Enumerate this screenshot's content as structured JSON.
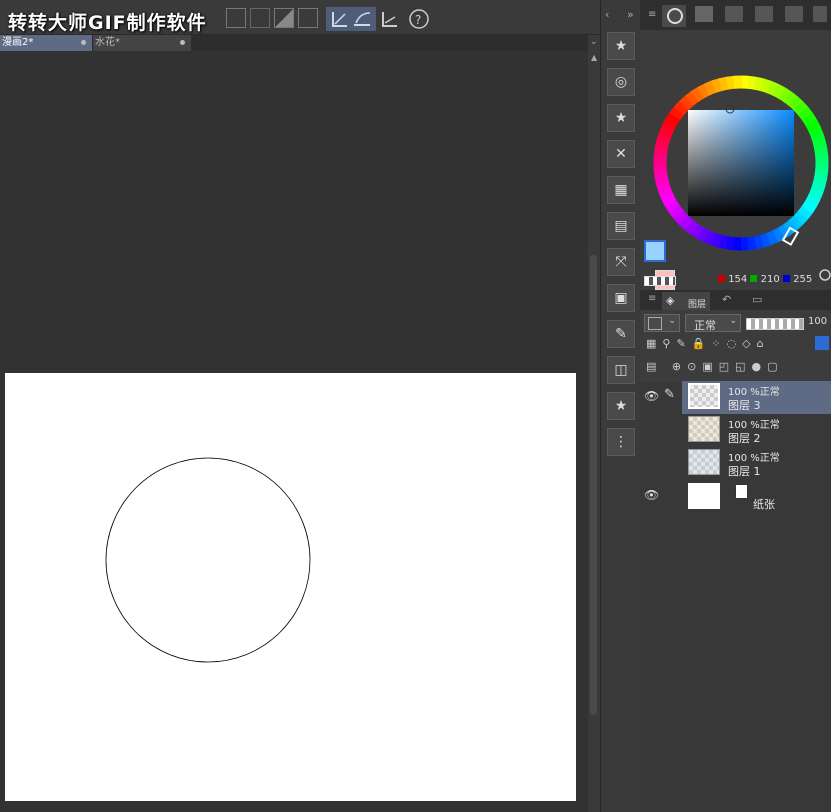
{
  "watermark": "转转大师GIF制作软件",
  "tabs": [
    {
      "label": "漫画2*"
    },
    {
      "label": "水花*"
    }
  ],
  "colors": {
    "main_color": "#9ad2ff",
    "sub_color": "#ffc0c0",
    "r": "154",
    "g": "210",
    "b": "255"
  },
  "layer_panel": {
    "tab_label": "图层",
    "blend_mode": "正常",
    "opacity": "100"
  },
  "layers": [
    {
      "opacity_mode": "100 %正常",
      "name": "图层 3",
      "selected": true
    },
    {
      "opacity_mode": "100 %正常",
      "name": "图层 2",
      "selected": false
    },
    {
      "opacity_mode": "100 %正常",
      "name": "图层 1",
      "selected": false
    },
    {
      "name": "纸张"
    }
  ],
  "icons": {
    "left_strip": [
      "favorites-icon",
      "navigator-icon",
      "material-folder-icon",
      "delete-icon",
      "tone-icon",
      "sub-view-icon",
      "transform-icon",
      "layer-property-icon",
      "edit-icon",
      "3d-icon",
      "favorites-2-icon",
      "timeline-icon"
    ]
  }
}
